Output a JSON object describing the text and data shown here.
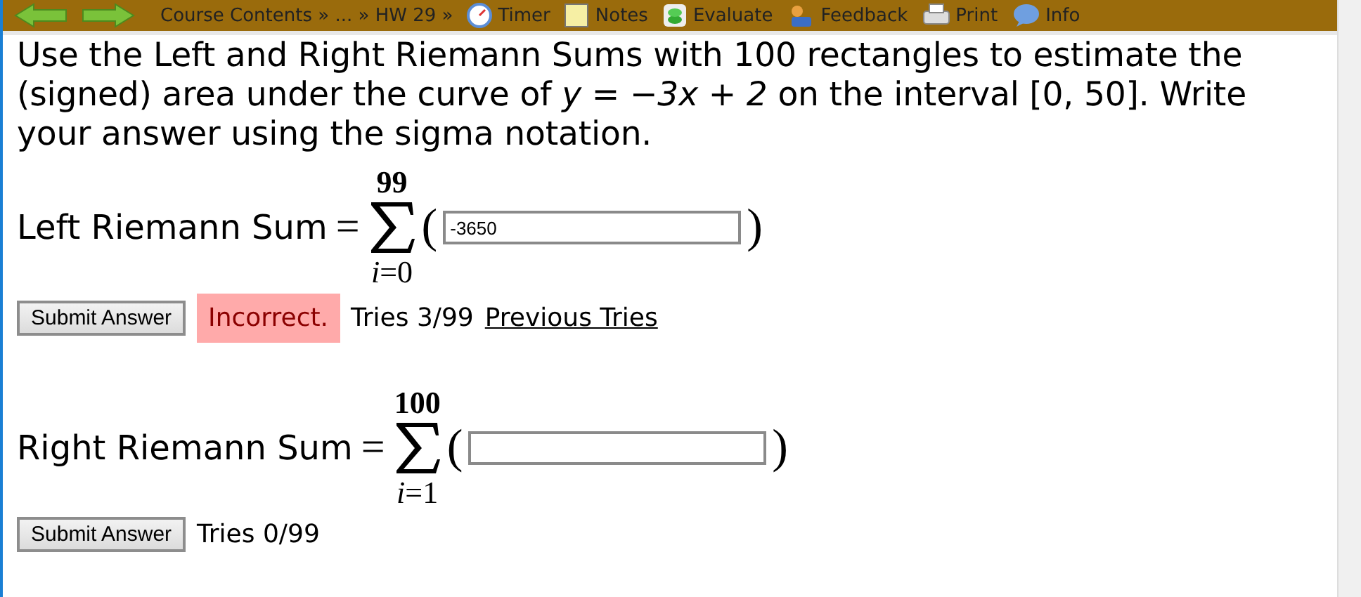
{
  "toolbar": {
    "breadcrumb": "Course Contents » ... » HW 29 »",
    "items": [
      {
        "kind": "timer",
        "label": "Timer"
      },
      {
        "kind": "notes",
        "label": "Notes"
      },
      {
        "kind": "evaluate",
        "label": "Evaluate"
      },
      {
        "kind": "feedback",
        "label": "Feedback"
      },
      {
        "kind": "print",
        "label": "Print"
      },
      {
        "kind": "info",
        "label": "Info"
      }
    ]
  },
  "question": "Use the Left and Right Riemann Sums with 100 rectangles to estimate the (signed) area under the curve of *y = −3x + 2* on the interval [0, 50]. Write your answer using the sigma notation.",
  "parts": [
    {
      "label": "Left Riemann Sum",
      "equals": "=",
      "upper": "99",
      "lower": "*i*=0",
      "open": "(",
      "close": ")",
      "value": "-3650",
      "button": "Submit Answer",
      "feedback": "Incorrect.",
      "correct": false,
      "tries": "Tries 3/99",
      "link": "Previous Tries"
    },
    {
      "label": "Right Riemann Sum",
      "equals": "=",
      "upper": "100",
      "lower": "*i*=1",
      "open": "(",
      "close": ")",
      "button": "Submit Answer",
      "tries": "Tries 0/99"
    }
  ]
}
